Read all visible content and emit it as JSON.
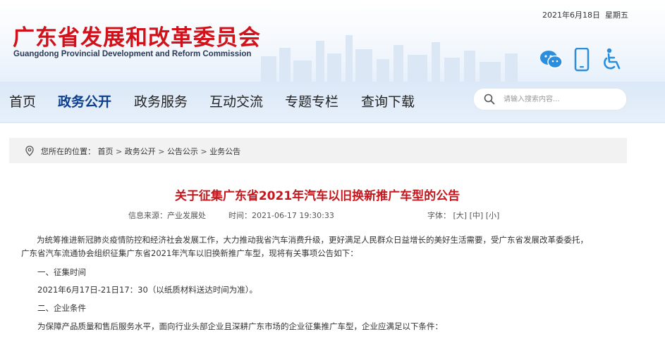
{
  "header": {
    "date": "2021年6月18日",
    "weekday": "星期五",
    "logo_cn": "广东省发展和改革委员会",
    "logo_en": "Guangdong Provincial Development and Reform Commission",
    "icons": [
      "wechat-icon",
      "mobile-icon",
      "accessibility-icon"
    ],
    "icon_color": "#2b8ddb"
  },
  "nav": {
    "items": [
      {
        "label": "首页"
      },
      {
        "label": "政务公开",
        "active": true
      },
      {
        "label": "政务服务"
      },
      {
        "label": "互动交流"
      },
      {
        "label": "专题专栏"
      },
      {
        "label": "查询下载"
      }
    ],
    "search_placeholder": "请输入搜索内容..."
  },
  "breadcrumb": {
    "label": "您所在的位置：",
    "items": [
      "首页",
      "政务公开",
      "公告公示",
      "业务公告"
    ],
    "separator": ">"
  },
  "article": {
    "title": "关于征集广东省2021年汽车以旧换新推广车型的公告",
    "source": "信息来源：产业发展处",
    "time": "时间：2021-06-17 19:30:33",
    "font_label": "字体：",
    "font_sizes": [
      "[大]",
      "[中]",
      "[小]"
    ],
    "intro_line1": "为统筹推进新冠肺炎疫情防控和经济社会发展工作，大力推动我省汽车消费升级，更好满足人民群众日益增长的美好生活需要，受广东省发展改革委委托，",
    "intro_line2": "广东省汽车流通协会组织征集广东省2021年汽车以旧换新推广车型，现将有关事项公告如下：",
    "section1_heading": "一、征集时间",
    "section1_text": "2021年6月17日-21日17：30（以纸质材料送达时间为准）。",
    "section2_heading": "二、企业条件",
    "section2_text": "为保障产品质量和售后服务水平，面向行业头部企业且深耕广东市场的企业征集推广车型，企业应满足以下条件："
  },
  "colors": {
    "logo_red": "#d2121a",
    "title_red": "#c4161c",
    "nav_active": "#0a3e8f",
    "nav_bg": "#dbe8f7"
  }
}
